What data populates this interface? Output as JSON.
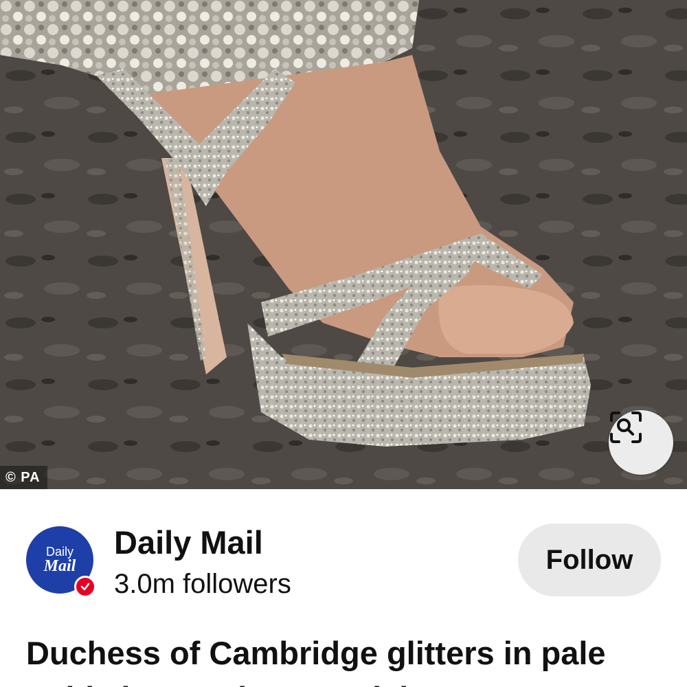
{
  "image": {
    "subject": "sandal-photo",
    "credit": "© PA",
    "lens_icon": "visual-search-icon",
    "colors": {
      "ground": "#4a4540",
      "skin": "#c99a80",
      "sparkle": "#cfcdc5"
    }
  },
  "publisher": {
    "name": "Daily Mail",
    "followers": "3.0m followers",
    "avatar_line1": "Daily",
    "avatar_line2": "Mail",
    "avatar_color": "#1e3fa8",
    "verified_icon": "verified-check-icon",
    "verified_color": "#e60023"
  },
  "follow_label": "Follow",
  "headline": "Duchess of Cambridge glitters in pale gold Jimmy Choo sandals"
}
